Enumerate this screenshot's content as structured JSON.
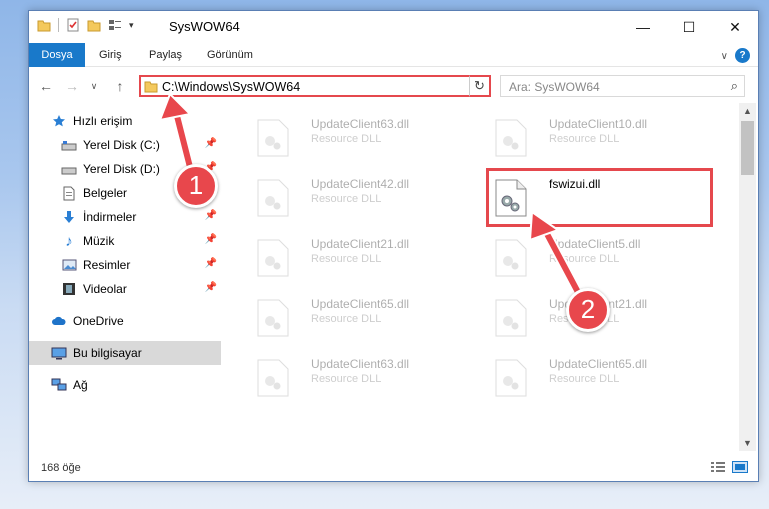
{
  "window": {
    "title": "SysWOW64"
  },
  "ribbon": {
    "tabs": [
      "Dosya",
      "Giriş",
      "Paylaş",
      "Görünüm"
    ]
  },
  "address": {
    "path": "C:\\Windows\\SysWOW64"
  },
  "search": {
    "placeholder": "Ara: SysWOW64"
  },
  "sidebar": {
    "items": [
      {
        "label": "Hızlı erişim",
        "icon": "star-icon"
      },
      {
        "label": "Yerel Disk (C:)",
        "icon": "drive-icon",
        "pinned": true
      },
      {
        "label": "Yerel Disk (D:)",
        "icon": "drive-icon",
        "pinned": true
      },
      {
        "label": "Belgeler",
        "icon": "document-icon",
        "pinned": true
      },
      {
        "label": "İndirmeler",
        "icon": "download-icon",
        "pinned": true
      },
      {
        "label": "Müzik",
        "icon": "music-icon",
        "pinned": true
      },
      {
        "label": "Resimler",
        "icon": "pictures-icon",
        "pinned": true
      },
      {
        "label": "Videolar",
        "icon": "video-icon",
        "pinned": true
      },
      {
        "label": "OneDrive",
        "icon": "cloud-icon"
      },
      {
        "label": "Bu bilgisayar",
        "icon": "computer-icon",
        "selected": true
      },
      {
        "label": "Ağ",
        "icon": "network-icon"
      }
    ]
  },
  "files": [
    {
      "name": "UpdateClient63.dll",
      "type": "Resource DLL"
    },
    {
      "name": "UpdateClient10.dll",
      "type": "Resource DLL"
    },
    {
      "name": "UpdateClient42.dll",
      "type": "Resource DLL"
    },
    {
      "name": "fswizui.dll",
      "type": "",
      "highlighted": true
    },
    {
      "name": "UpdateClient21.dll",
      "type": "Resource DLL"
    },
    {
      "name": "UpdateClient5.dll",
      "type": "Resource DLL"
    },
    {
      "name": "UpdateClient65.dll",
      "type": "Resource DLL"
    },
    {
      "name": "UpdateClient21.dll",
      "type": "Resource DLL"
    },
    {
      "name": "UpdateClient63.dll",
      "type": "Resource DLL"
    },
    {
      "name": "UpdateClient65.dll",
      "type": "Resource DLL"
    }
  ],
  "status": {
    "count": "168 öğe"
  },
  "annotations": {
    "step1": "1",
    "step2": "2"
  },
  "colors": {
    "accent": "#1979ca",
    "highlight": "#e5484d"
  }
}
